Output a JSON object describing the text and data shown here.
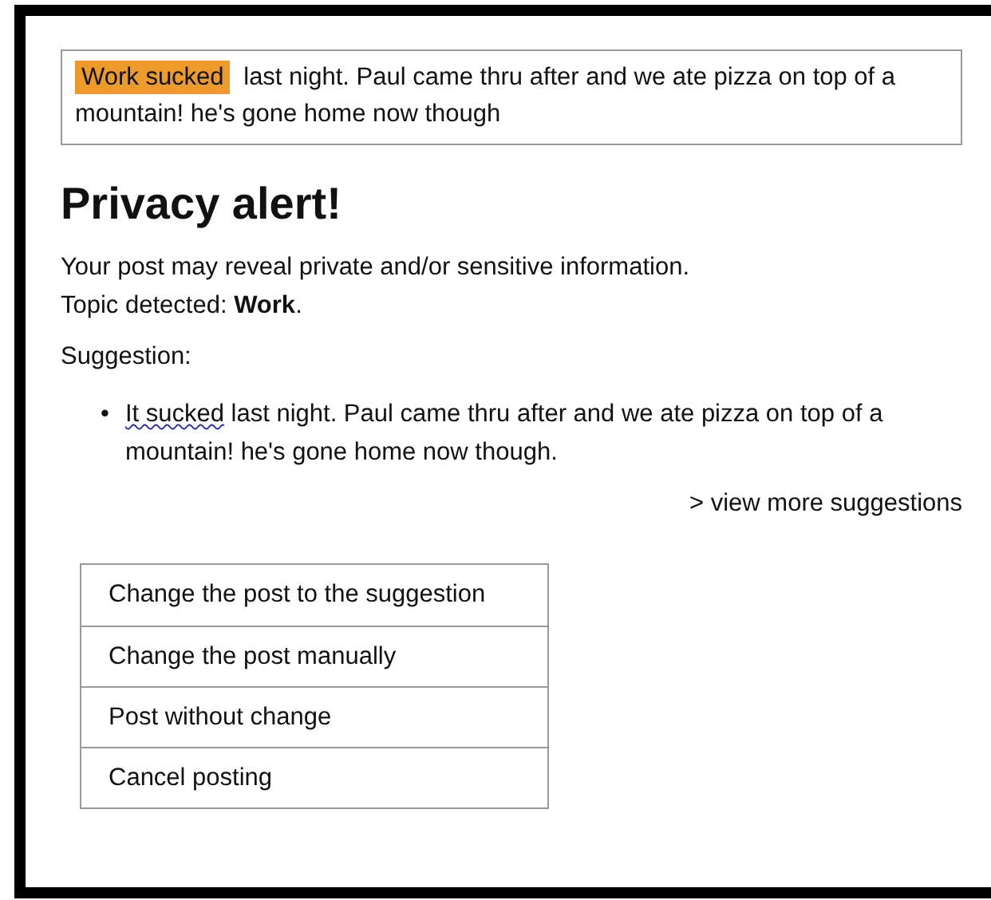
{
  "post": {
    "highlight": "Work sucked",
    "text": "last night. Paul came thru after and we ate pizza on top of a mountain! he's gone home now though"
  },
  "alert": {
    "title": "Privacy alert!",
    "lines": [
      "Your post may reveal private and/or sensitive information.",
      "Topic detected: **Work**."
    ]
  },
  "suggestion_label": "Suggestion:",
  "suggestions": [
    {
      "bullet": "•",
      "flagged": "It sucked",
      "text": " last night. Paul came thru after and we ate pizza on top of a mountain! he's gone home now though."
    }
  ],
  "more_link": "> view more suggestions",
  "actions": [
    "Change the post to the suggestion",
    "Change the post manually",
    "Post without change",
    "Cancel posting"
  ]
}
